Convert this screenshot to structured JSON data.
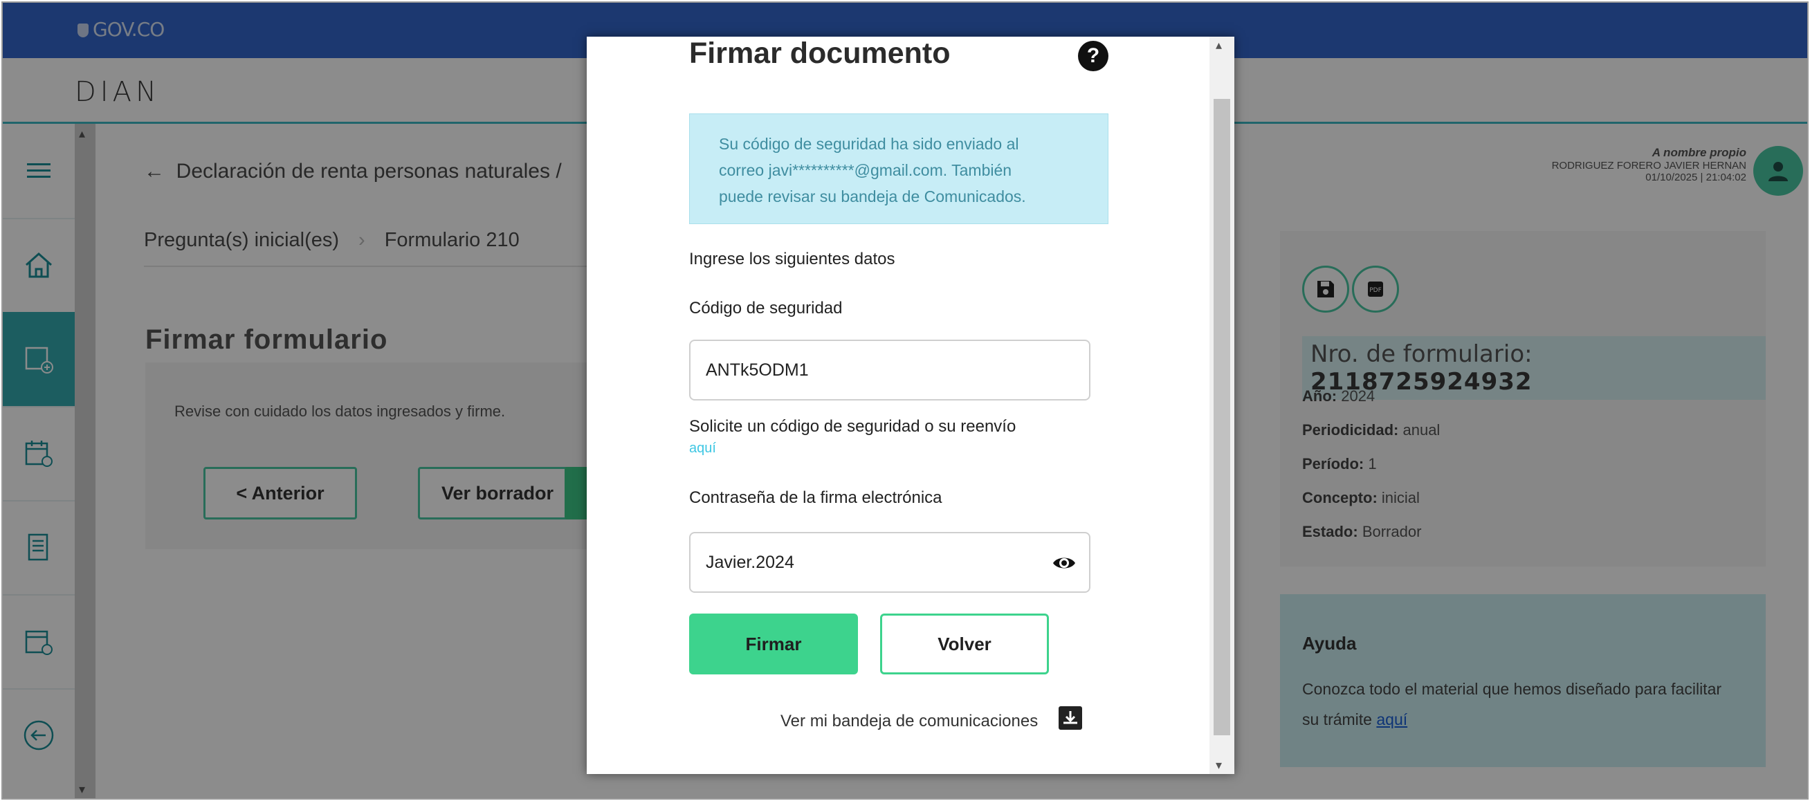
{
  "header": {
    "gov_logo": "GOV.CO",
    "brand": "DIAN"
  },
  "sidebar": {
    "items": [
      {
        "icon": "menu-icon"
      },
      {
        "icon": "home-icon"
      },
      {
        "icon": "form-add-icon"
      },
      {
        "icon": "calendar-add-icon"
      },
      {
        "icon": "document-list-icon"
      },
      {
        "icon": "calendar-money-icon"
      },
      {
        "icon": "back-circle-icon"
      }
    ]
  },
  "page": {
    "back_label": "Declaración de renta personas naturales /",
    "breadcrumb": [
      "Pregunta(s) inicial(es)",
      "Formulario 210"
    ],
    "title": "Firmar formulario",
    "instruction": "Revise con cuidado los datos ingresados y firme.",
    "btn_prev": "< Anterior",
    "btn_draft": "Ver borrador"
  },
  "user": {
    "on_behalf": "A nombre propio",
    "name": "RODRIGUEZ FORERO JAVIER HERNAN",
    "datetime": "01/10/2025 | 21:04:02"
  },
  "form_panel": {
    "form_no_label": "Nro. de formulario:",
    "form_no_value": "2118725924932",
    "year_label": "Año:",
    "year_value": "2024",
    "periodicity_label": "Periodicidad:",
    "periodicity_value": "anual",
    "period_label": "Período:",
    "period_value": "1",
    "concept_label": "Concepto:",
    "concept_value": "inicial",
    "status_label": "Estado:",
    "status_value": "Borrador"
  },
  "help": {
    "title": "Ayuda",
    "text": "Conozca todo el material que hemos diseñado para facilitar su trámite",
    "link": "aquí"
  },
  "modal": {
    "title": "Firmar documento",
    "alert_line1": "Su código de seguridad ha sido enviado al",
    "alert_line2": "correo javi**********@gmail.com. También",
    "alert_line3": "puede revisar su bandeja de Comunicados.",
    "enter_data": "Ingrese los siguientes datos",
    "code_label": "Código de seguridad",
    "code_value": "ANTk5ODM1",
    "request_code": "Solicite un código de seguridad o su reenvío",
    "request_link": "aquí",
    "password_label": "Contraseña de la firma electrónica",
    "password_value": "Javier.2024",
    "btn_sign": "Firmar",
    "btn_back": "Volver",
    "inbox_link": "Ver mi bandeja de comunicaciones"
  },
  "colors": {
    "top_bar": "#3366cc",
    "accent": "#4ac7a2",
    "sign_button": "#3dd38d",
    "alert_bg": "#c7edf6"
  }
}
